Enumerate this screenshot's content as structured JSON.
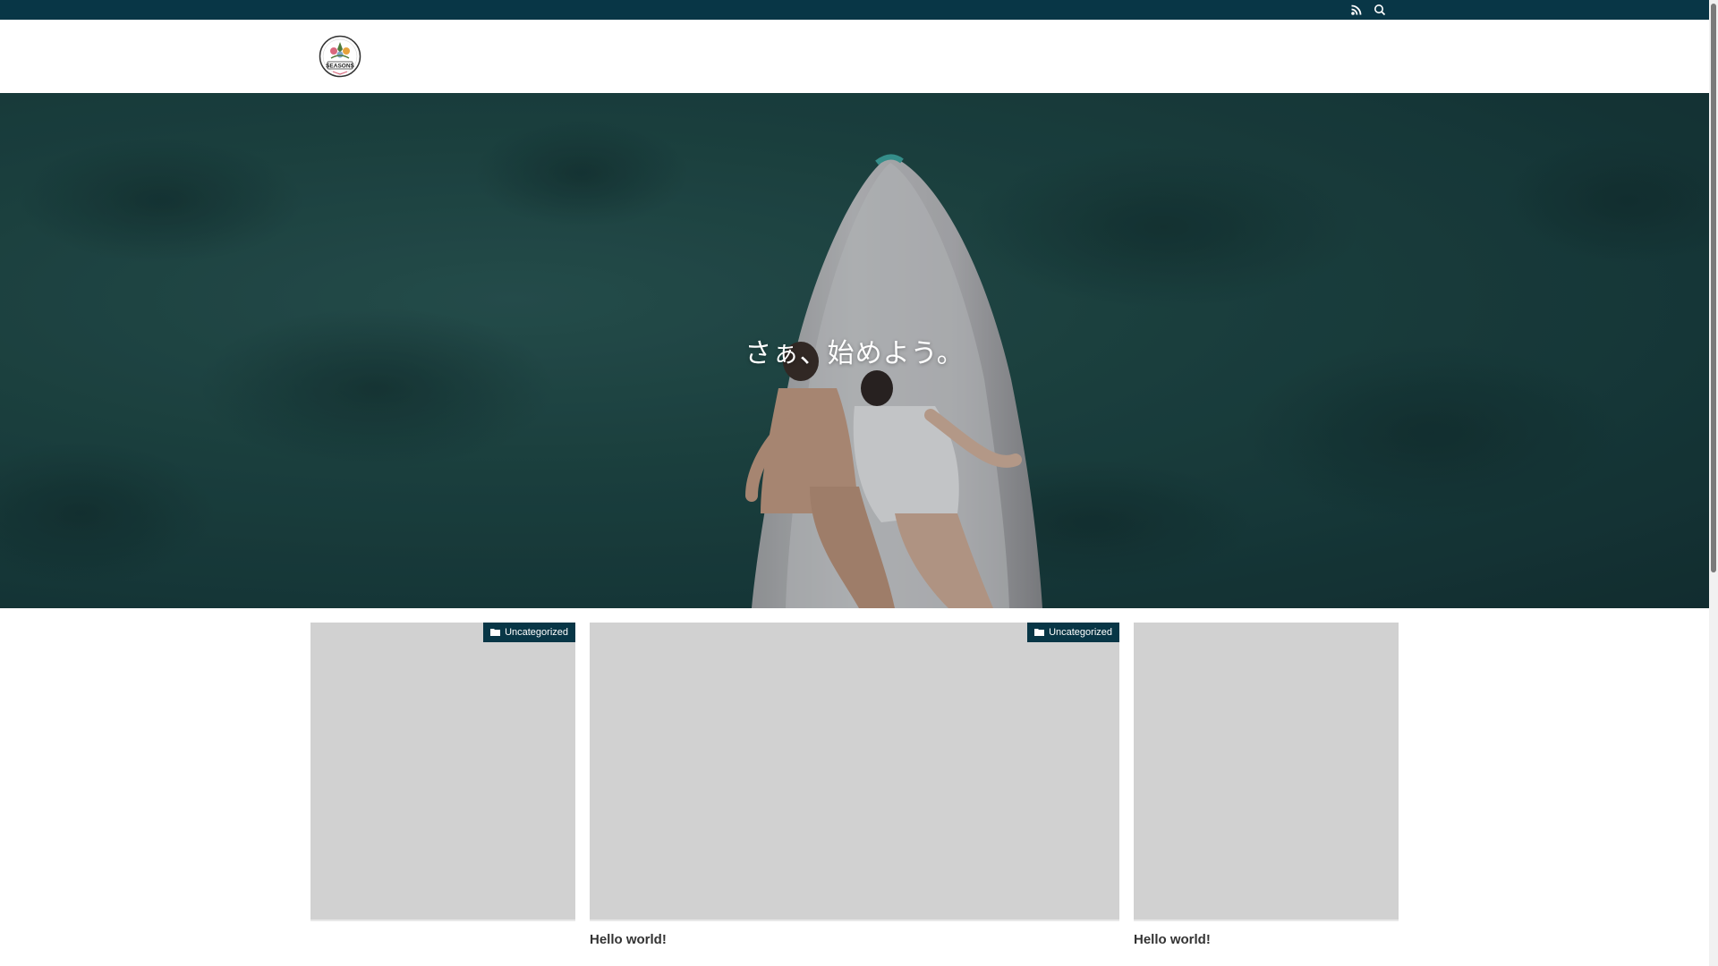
{
  "topbar": {
    "icons": [
      "rss-icon",
      "search-icon"
    ],
    "background": "#083646"
  },
  "header": {
    "logo_text": "SEASONS"
  },
  "hero": {
    "catchphrase": "さぁ、始めよう。"
  },
  "posts": [
    {
      "category": "Uncategorized",
      "title": ""
    },
    {
      "category": "Uncategorized",
      "title": "Hello world!"
    },
    {
      "category": "",
      "title": "Hello world!"
    }
  ],
  "colors": {
    "accent": "#083646",
    "thumb_placeholder": "#d1d1d1",
    "hero_water": "#1f4744"
  }
}
